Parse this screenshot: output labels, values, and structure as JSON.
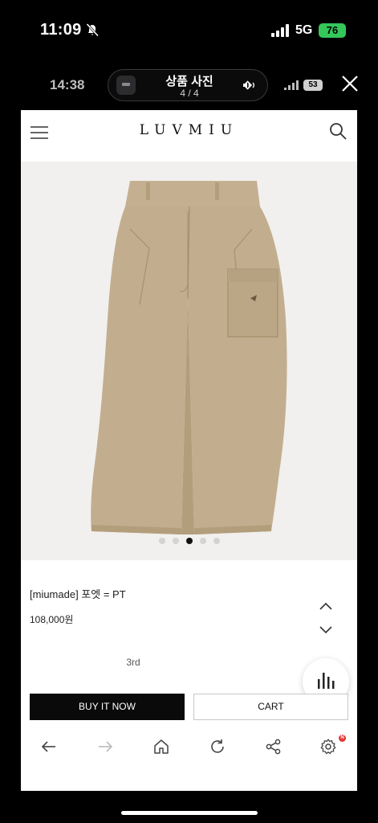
{
  "status_bar": {
    "time": "11:09",
    "network": "5G",
    "battery": "76"
  },
  "viewer_bar": {
    "time": "14:38",
    "title": "상품 사진",
    "counter": "4 / 4",
    "battery": "53"
  },
  "site": {
    "logo": "LUVMIU"
  },
  "carousel": {
    "slide_count": 5,
    "active_index": 2
  },
  "product": {
    "name": "[miumade] 포엣 = PT",
    "price": "108,000원",
    "option": "3rd"
  },
  "actions": {
    "buy_label": "BUY IT NOW",
    "cart_label": "CART"
  },
  "toolbar": {
    "badge": "N"
  },
  "colors": {
    "accent_battery": "#34c759",
    "buy_button": "#0a0a0a",
    "badge": "#e53935",
    "pants": "#c2ae8e"
  }
}
